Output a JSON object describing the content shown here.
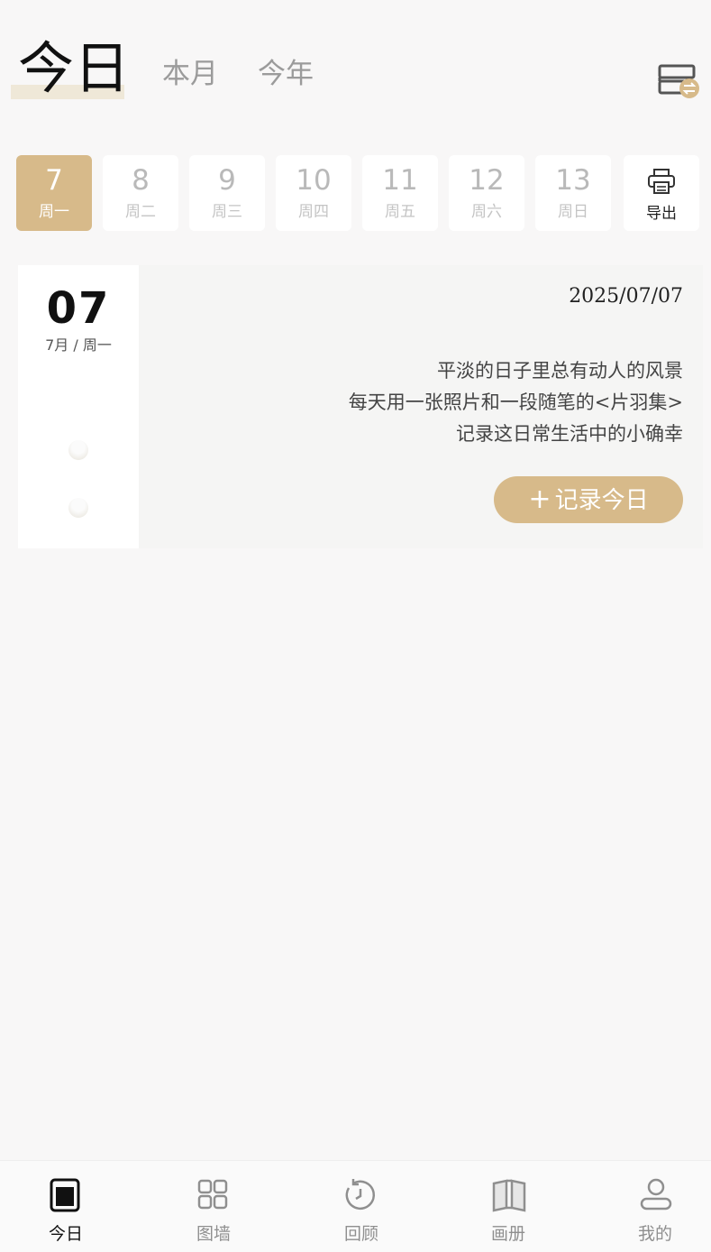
{
  "header": {
    "tabs": [
      {
        "label": "今日",
        "active": true
      },
      {
        "label": "本月",
        "active": false
      },
      {
        "label": "今年",
        "active": false
      }
    ],
    "switch_icon": "books-swap-icon"
  },
  "week": {
    "days": [
      {
        "num": "7",
        "weekday": "周一",
        "active": true
      },
      {
        "num": "8",
        "weekday": "周二",
        "active": false
      },
      {
        "num": "9",
        "weekday": "周三",
        "active": false
      },
      {
        "num": "10",
        "weekday": "周四",
        "active": false
      },
      {
        "num": "11",
        "weekday": "周五",
        "active": false
      },
      {
        "num": "12",
        "weekday": "周六",
        "active": false
      },
      {
        "num": "13",
        "weekday": "周日",
        "active": false
      }
    ],
    "export": {
      "label": "导出",
      "icon": "printer-icon"
    }
  },
  "card": {
    "big_day": "07",
    "small_date": "7月 / 周一",
    "date": "2025/07/07",
    "poem": [
      "平淡的日子里总有动人的风景",
      "每天用一张照片和一段随笔的<片羽集>",
      "记录这日常生活中的小确幸"
    ],
    "record_plus": "+",
    "record_label": "记录今日"
  },
  "nav": {
    "items": [
      {
        "label": "今日",
        "icon": "today-card-icon",
        "active": true
      },
      {
        "label": "图墙",
        "icon": "grid-icon",
        "active": false
      },
      {
        "label": "回顾",
        "icon": "history-clock-icon",
        "active": false
      },
      {
        "label": "画册",
        "icon": "open-book-icon",
        "active": false
      },
      {
        "label": "我的",
        "icon": "profile-icon",
        "active": false
      }
    ]
  },
  "colors": {
    "accent": "#d7ba8a",
    "background": "#f8f7f7"
  }
}
